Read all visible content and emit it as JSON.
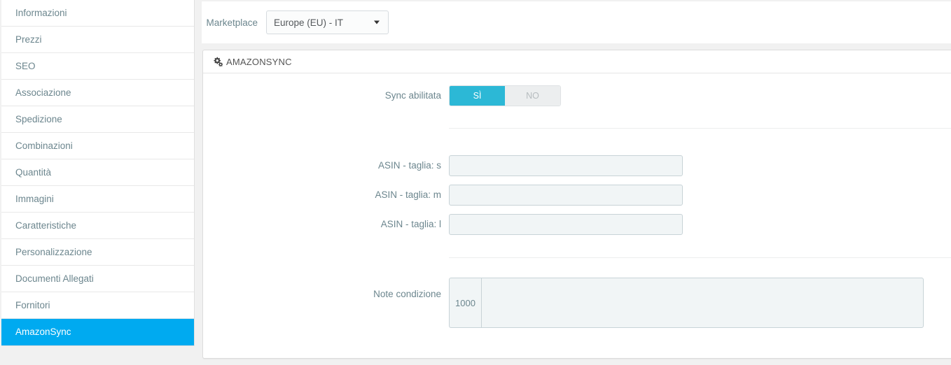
{
  "sidebar": {
    "items": [
      {
        "label": "Informazioni",
        "active": false
      },
      {
        "label": "Prezzi",
        "active": false
      },
      {
        "label": "SEO",
        "active": false
      },
      {
        "label": "Associazione",
        "active": false
      },
      {
        "label": "Spedizione",
        "active": false
      },
      {
        "label": "Combinazioni",
        "active": false
      },
      {
        "label": "Quantità",
        "active": false
      },
      {
        "label": "Immagini",
        "active": false
      },
      {
        "label": "Caratteristiche",
        "active": false
      },
      {
        "label": "Personalizzazione",
        "active": false
      },
      {
        "label": "Documenti Allegati",
        "active": false
      },
      {
        "label": "Fornitori",
        "active": false
      },
      {
        "label": "AmazonSync",
        "active": true
      }
    ],
    "active_color": "#00aaf0"
  },
  "topbar": {
    "marketplace_label": "Marketplace",
    "marketplace_value": "Europe (EU) - IT",
    "marketplace_options": [
      "Europe (EU) - IT"
    ]
  },
  "panel": {
    "title": "AMAZONSYNC",
    "icon": "cogs-icon"
  },
  "form": {
    "sync": {
      "label": "Sync abilitata",
      "on_label": "SÌ",
      "off_label": "NO",
      "value": "SÌ",
      "on_color": "#2cb8d6",
      "off_color": "#eceeef"
    },
    "asin_s": {
      "label": "ASIN - taglia: s",
      "value": "",
      "placeholder": ""
    },
    "asin_m": {
      "label": "ASIN - taglia: m",
      "value": "",
      "placeholder": ""
    },
    "asin_l": {
      "label": "ASIN - taglia: l",
      "value": "",
      "placeholder": ""
    },
    "note": {
      "label": "Note condizione",
      "counter": "1000",
      "value": "",
      "placeholder": ""
    }
  }
}
